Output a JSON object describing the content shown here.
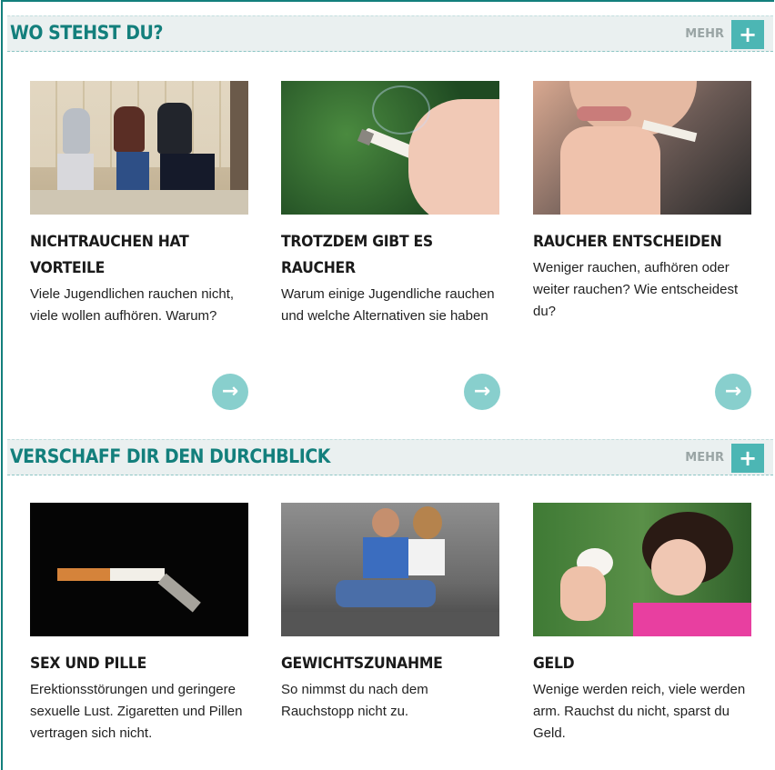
{
  "section1": {
    "title": "WO STEHST DU?",
    "more_label": "MEHR",
    "more_icon": "plus-icon",
    "cards": [
      {
        "title": "NICHTRAUCHEN HAT VORTEILE",
        "text": "Viele Jugendlichen rauchen nicht, viele wollen aufhören. Warum?",
        "image": "teenagers-sitting-on-wall"
      },
      {
        "title": "TROTZDEM GIBT ES RAUCHER",
        "text": "Warum einige Jugendliche rauchen und welche Alternativen sie haben",
        "image": "hand-holding-cigarette"
      },
      {
        "title": "RAUCHER ENTSCHEIDEN",
        "text": "Weniger rauchen, aufhören oder weiter rauchen? Wie entscheidest du?",
        "image": "woman-smoking"
      }
    ]
  },
  "section2": {
    "title": "VERSCHAFF DIR DEN DURCHBLICK",
    "more_label": "MEHR",
    "more_icon": "plus-icon",
    "cards": [
      {
        "title": "SEX UND PILLE",
        "text": "Erektionsstörungen und geringere sexuelle Lust. Zigaretten und Pillen vertragen sich nicht.",
        "image": "bent-cigarette"
      },
      {
        "title": "GEWICHTSZUNAHME",
        "text": "So nimmst du nach dem Rauchstopp nicht zu.",
        "image": "teen-couple-sitting"
      },
      {
        "title": "GELD",
        "text": "Wenige werden reich, viele werden arm. Rauchst du nicht, sparst du Geld.",
        "image": "girl-with-piggy-bank"
      }
    ]
  },
  "colors": {
    "accent": "#137f7c",
    "button": "#4cb6b4",
    "arrow": "#88cfcd",
    "header_bg": "#eaf0f0"
  },
  "icons": {
    "arrow": "arrow-right-icon"
  }
}
